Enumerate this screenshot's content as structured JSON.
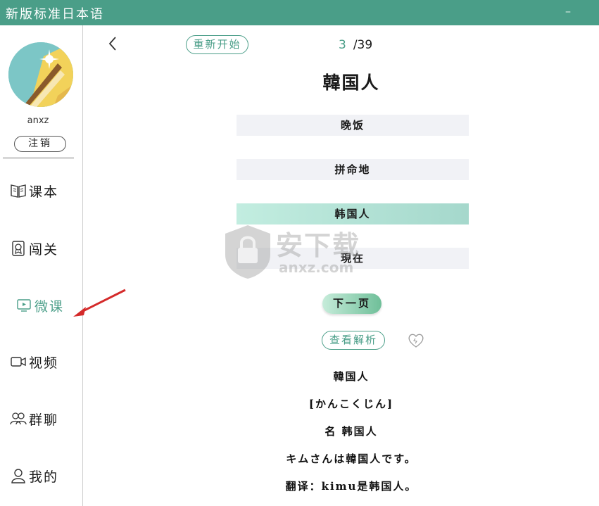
{
  "window": {
    "title": "新版标准日本语",
    "minimize_symbol": "–",
    "maximize_symbol": "□"
  },
  "sidebar": {
    "username": "anxz",
    "logout_label": "注销",
    "items": [
      {
        "label": "课本",
        "icon": "book-icon"
      },
      {
        "label": "闯关",
        "icon": "badge-icon"
      },
      {
        "label": "微课",
        "icon": "video-lesson-icon",
        "active": true
      },
      {
        "label": "视频",
        "icon": "video-camera-icon"
      },
      {
        "label": "群聊",
        "icon": "group-icon"
      },
      {
        "label": "我的",
        "icon": "user-icon"
      }
    ]
  },
  "quiz": {
    "restart_label": "重新开始",
    "current": "3",
    "total": "/39",
    "question": "韓国人",
    "options": [
      "晚饭",
      "拼命地",
      "韩国人",
      "現在"
    ],
    "selected_index": 2,
    "next_label": "下一页",
    "analysis_label": "查看解析"
  },
  "explanation": {
    "word": "韓国人",
    "reading": "[かんこくじん]",
    "meaning": "名 韩国人",
    "example": "キムさんは韓国人です。",
    "translation": "翻译：kimu是韩国人。"
  },
  "watermark": {
    "text": "安下载",
    "url": "anxz.com"
  },
  "colors": {
    "accent": "#4a9e88",
    "option_bg": "#f1f2f6",
    "selected_option": "#a5d8cc",
    "annotation_arrow": "#d42a2a"
  }
}
